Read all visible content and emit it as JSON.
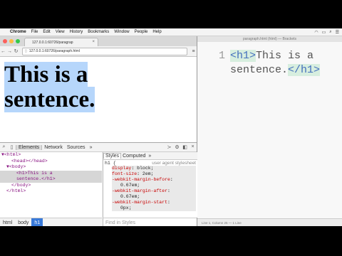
{
  "menubar": {
    "apple": "",
    "items": [
      "Chrome",
      "File",
      "Edit",
      "View",
      "History",
      "Bookmarks",
      "Window",
      "People",
      "Help"
    ]
  },
  "browser": {
    "tab_title": "127.0.0.1:60726/paragrap",
    "url": "127.0.0.1:60726/paragraph.html",
    "heading_line1": "This is a",
    "heading_line2": "sentence."
  },
  "devtools": {
    "tabs": [
      "Elements",
      "Network",
      "Sources"
    ],
    "more": "»",
    "dom_lines": [
      {
        "text": "▼<html>",
        "indent": 0
      },
      {
        "text": "<head></head>",
        "indent": 2
      },
      {
        "text": "▼<body>",
        "indent": 1
      },
      {
        "text": "<h1>This is a",
        "indent": 2
      },
      {
        "text": "sentence.</h1>",
        "indent": 2
      },
      {
        "text": "</body>",
        "indent": 1
      },
      {
        "text": "</html>",
        "indent": 0
      }
    ],
    "styles_tabs": [
      "Styles",
      "Computed"
    ],
    "rule_selector": "h1 {",
    "rule_source": "user agent stylesheet",
    "props": [
      {
        "name": "display",
        "value": "block;"
      },
      {
        "name": "font-size",
        "value": "2em;"
      },
      {
        "name": "-webkit-margin-before",
        "value": ""
      },
      {
        "name": "",
        "value": "0.67em;"
      },
      {
        "name": "-webkit-margin-after",
        "value": ""
      },
      {
        "name": "",
        "value": "0.67em;"
      },
      {
        "name": "-webkit-margin-start",
        "value": ""
      },
      {
        "name": "",
        "value": "0px;"
      }
    ],
    "breadcrumbs": [
      "html",
      "body",
      "h1"
    ],
    "find_placeholder": "Find in Styles"
  },
  "editor": {
    "title": "paragraph.html (html) — Brackets",
    "line_number": "1",
    "code_line1_tag": "<h1>",
    "code_line1_text": "This is a",
    "code_line2_text": "sentence.",
    "code_line2_tag": "</h1>",
    "status": "Line 1, Column 25 — 1 Line"
  }
}
